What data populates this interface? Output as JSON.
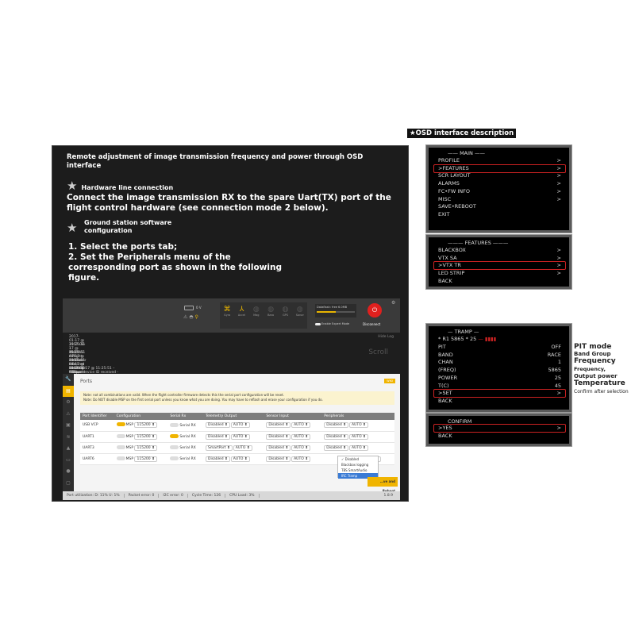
{
  "intro": {
    "title": "Remote adjustment of image transmission frequency and power through OSD interface",
    "hw_heading": "Hardware line connection",
    "hw_text": "Connect the image transmission RX to the spare Uart(TX) port of the flight control hardware (see connection mode 2 below).",
    "gs_heading": "Ground station software configuration",
    "step1": "1. Select the ports tab;",
    "step2": "2. Set the Peripherals menu of the corresponding port as shown in the following figure."
  },
  "configurator": {
    "battery": "0 V",
    "sensors": [
      "Gyro",
      "Accel",
      "Mag",
      "Baro",
      "GPS",
      "Sonar"
    ],
    "dataflash": "Dataflash: free 6.0MB",
    "expert": "Enable Expert Mode",
    "disconnect": "Disconnect",
    "hide_log": "Hide Log",
    "scroll": "Scroll",
    "log": [
      "2017-01-17 @ 11:25:51 – MultiWii API version received - 1.28.0",
      "2017-01-17 @ 11:25:51 – Flight controller info, identifier: BTFL, version: 3.1.0",
      "2017-01-17 @ 11:25:51 – Running firmware released on: Jan 17 2017 11:23:01",
      "2017-01-17 @ 11:25:51 – Board: OBF4, version: 0",
      "2017-01-17 @ 11:25:51 – Unique device ID received - 0x2600453535510637393930"
    ],
    "ports_title": "Ports",
    "wiki": "WIKI",
    "note1": "Note: not all combinations are valid. When the flight controller firmware detects this the serial port configuration will be reset.",
    "note2": "Note: Do NOT disable MSP on the first serial port unless you know what you are doing. You may have to reflash and erase your configuration if you do.",
    "columns": [
      "Port Identifier",
      "Configuration",
      "Serial Rx",
      "Telemetry Output",
      "Sensor Input",
      "Peripherals"
    ],
    "rows": [
      {
        "id": "USB VCP",
        "msp": true,
        "baud": "115200",
        "rx": false,
        "tele": "Disabled",
        "sensor": "Disabled",
        "periph": "Disabled"
      },
      {
        "id": "UART1",
        "msp": false,
        "baud": "115200",
        "rx": true,
        "tele": "Disabled",
        "sensor": "Disabled",
        "periph": "Disabled"
      },
      {
        "id": "UART3",
        "msp": false,
        "baud": "115200",
        "rx": false,
        "tele": "SmartPort",
        "sensor": "Disabled",
        "periph": "Disabled"
      },
      {
        "id": "UART6",
        "msp": false,
        "baud": "115200",
        "rx": false,
        "tele": "Disabled",
        "sensor": "Disabled",
        "periph": ""
      }
    ],
    "msp_label": "MSP",
    "rx_label": "Serial RX",
    "auto": "AUTO",
    "dropdown": [
      "✓ Disabled",
      "Blackbox logging",
      "TBS SmartAudio",
      "IRC Tramp"
    ],
    "save": "…ve and Reboot",
    "status": [
      "Port utilization: D: 11% U: 1%",
      "Packet error: 0",
      "I2C error: 0",
      "Cycle Time: 126",
      "CPU Load: 3%"
    ],
    "version": "1.8.9"
  },
  "osd": {
    "title": "★OSD interface description",
    "main": {
      "header": "—— MAIN ——",
      "items": [
        [
          "PROFILE",
          ">"
        ],
        [
          ">FEATURES",
          ">"
        ],
        [
          "SCR LAYOUT",
          ">"
        ],
        [
          "ALARMS",
          ">"
        ],
        [
          "FC•FW INFO",
          ">"
        ],
        [
          "MISC",
          ">"
        ],
        [
          "SAVE•REBOOT",
          ""
        ],
        [
          "EXIT",
          ""
        ]
      ]
    },
    "features": {
      "header": "——— FEATURES ———",
      "items": [
        [
          "BLACKBOX",
          ">"
        ],
        [
          "VTX SA",
          ">"
        ],
        [
          ">VTX TR",
          ">"
        ],
        [
          "LED STRIP",
          ">"
        ],
        [
          "BACK",
          ""
        ]
      ]
    },
    "tramp": {
      "header": "— TRAMP —",
      "status": "*  R1 5865  *  25",
      "status_mark": "— ▮▮▮▮",
      "items": [
        [
          "PIT",
          "OFF"
        ],
        [
          "BAND",
          "RACE"
        ],
        [
          "CHAN",
          "1"
        ],
        [
          "(FREQ)",
          "5865"
        ],
        [
          "POWER",
          "25"
        ],
        [
          "T(C)",
          "45"
        ],
        [
          ">SET",
          ">"
        ],
        [
          "BACK",
          ""
        ]
      ]
    },
    "confirm": {
      "header": "CONFIRM",
      "items": [
        [
          ">YES",
          ">"
        ],
        [
          "BACK",
          ""
        ]
      ]
    },
    "callouts": [
      "PIT mode",
      "Band Group",
      "Frequency",
      "Frequency,",
      "Output power",
      "Temperature",
      "Confirm after selection"
    ],
    "highlight_color": "#cc2222"
  }
}
